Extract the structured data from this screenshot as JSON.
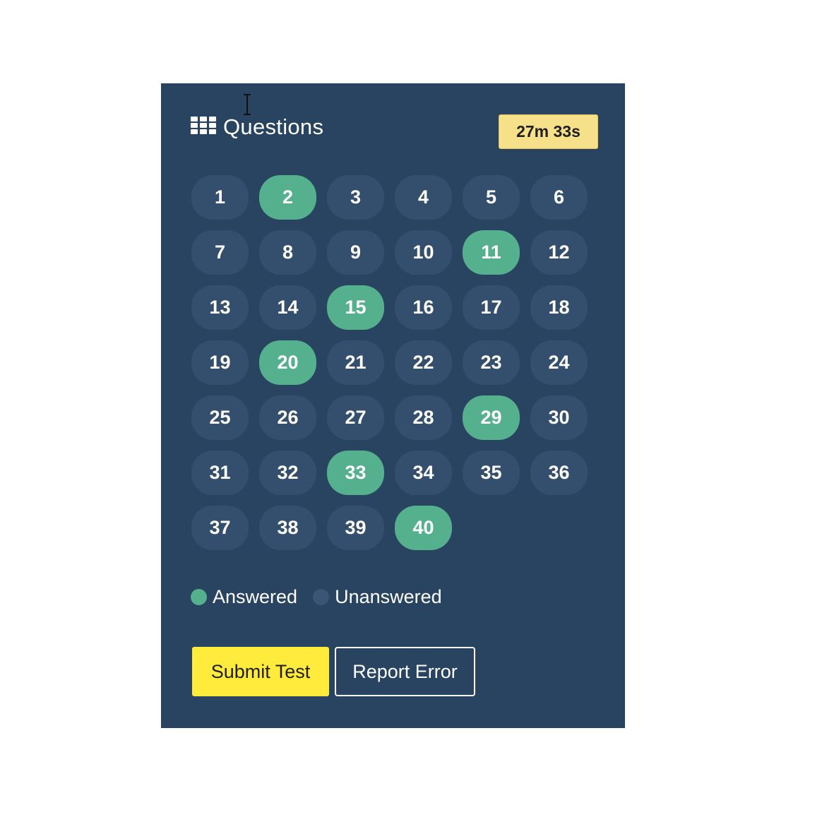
{
  "panel": {
    "title": "Questions",
    "title_icon": "grid-icon",
    "timer": "27m 33s",
    "cursor_icon": "text-cursor-icon"
  },
  "questions": [
    {
      "label": "1",
      "answered": false
    },
    {
      "label": "2",
      "answered": true
    },
    {
      "label": "3",
      "answered": false
    },
    {
      "label": "4",
      "answered": false
    },
    {
      "label": "5",
      "answered": false
    },
    {
      "label": "6",
      "answered": false
    },
    {
      "label": "7",
      "answered": false
    },
    {
      "label": "8",
      "answered": false
    },
    {
      "label": "9",
      "answered": false
    },
    {
      "label": "10",
      "answered": false
    },
    {
      "label": "11",
      "answered": true
    },
    {
      "label": "12",
      "answered": false
    },
    {
      "label": "13",
      "answered": false
    },
    {
      "label": "14",
      "answered": false
    },
    {
      "label": "15",
      "answered": true
    },
    {
      "label": "16",
      "answered": false
    },
    {
      "label": "17",
      "answered": false
    },
    {
      "label": "18",
      "answered": false
    },
    {
      "label": "19",
      "answered": false
    },
    {
      "label": "20",
      "answered": true
    },
    {
      "label": "21",
      "answered": false
    },
    {
      "label": "22",
      "answered": false
    },
    {
      "label": "23",
      "answered": false
    },
    {
      "label": "24",
      "answered": false
    },
    {
      "label": "25",
      "answered": false
    },
    {
      "label": "26",
      "answered": false
    },
    {
      "label": "27",
      "answered": false
    },
    {
      "label": "28",
      "answered": false
    },
    {
      "label": "29",
      "answered": true
    },
    {
      "label": "30",
      "answered": false
    },
    {
      "label": "31",
      "answered": false
    },
    {
      "label": "32",
      "answered": false
    },
    {
      "label": "33",
      "answered": true
    },
    {
      "label": "34",
      "answered": false
    },
    {
      "label": "35",
      "answered": false
    },
    {
      "label": "36",
      "answered": false
    },
    {
      "label": "37",
      "answered": false
    },
    {
      "label": "38",
      "answered": false
    },
    {
      "label": "39",
      "answered": false
    },
    {
      "label": "40",
      "answered": true
    }
  ],
  "legend": {
    "answered_label": "Answered",
    "unanswered_label": "Unanswered"
  },
  "buttons": {
    "submit_label": "Submit Test",
    "report_label": "Report Error"
  },
  "colors": {
    "panel_bg": "#284461",
    "unanswered": "#344f6d",
    "answered": "#55b08d",
    "timer_bg": "#f7e08a",
    "submit_bg": "#ffeb3b"
  }
}
